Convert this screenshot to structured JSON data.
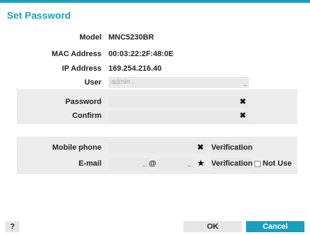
{
  "dialog": {
    "title": "Set Password"
  },
  "info": [
    {
      "label": "Model",
      "value": "MNC5230BR"
    },
    {
      "label": "MAC Address",
      "value": "00:03:22:2F:48:0E"
    },
    {
      "label": "IP Address",
      "value": "169.254.216.40"
    }
  ],
  "user": {
    "label": "User",
    "placeholder": "admin"
  },
  "password": {
    "label": "Password",
    "value": ""
  },
  "confirm": {
    "label": "Confirm",
    "value": ""
  },
  "mobile": {
    "label": "Mobile phone",
    "verify_label": "Verification"
  },
  "email": {
    "label": "E-mail",
    "at": "@",
    "verify_label": "Verification",
    "not_use_label": "Not Use"
  },
  "footer": {
    "help_label": "?",
    "ok_label": "OK",
    "cancel_label": "Cancel"
  },
  "colors": {
    "accent": "#1a9fbf",
    "panel": "#ececec",
    "field": "#e8e8e8"
  }
}
